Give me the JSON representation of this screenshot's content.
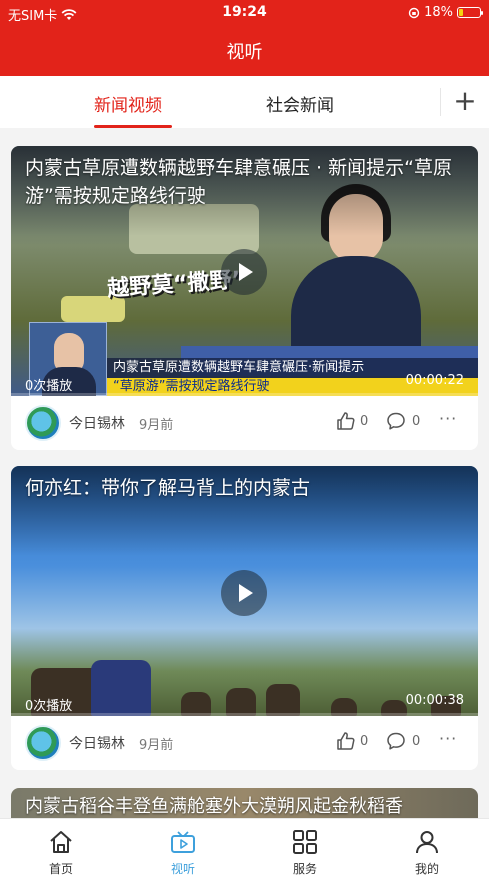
{
  "status_bar": {
    "carrier": "无SIM卡",
    "time": "19:24",
    "battery_percent": "18%",
    "battery_level": 0.18,
    "battery_color": "#f5d40f"
  },
  "header": {
    "title": "视听",
    "accent": "#e2231a"
  },
  "tabs": [
    {
      "label": "新闻视频",
      "active": true
    },
    {
      "label": "社会新闻",
      "active": false
    }
  ],
  "add_tab_icon": "plus-icon",
  "videos": [
    {
      "title": "内蒙古草原遭数辆越野车肆意碾压 · 新闻提示“草原游”需按规定路线行驶",
      "views": "0次播放",
      "duration": "00:00:22",
      "source": "今日锡林",
      "time": "9月前",
      "likes": "0",
      "comments": "0",
      "overlay_sign": "越野莫“撒野”",
      "ticker_line1": "内蒙古草原遭数辆越野车肆意碾压·新闻提示",
      "ticker_line2": "“草原游”需按规定路线行驶"
    },
    {
      "title": "何亦红：带你了解马背上的内蒙古",
      "views": "0次播放",
      "duration": "00:00:38",
      "source": "今日锡林",
      "time": "9月前",
      "likes": "0",
      "comments": "0"
    },
    {
      "title": "内蒙古稻谷丰登鱼满舱塞外大漠朔风起金秋稻香"
    }
  ],
  "bottom_nav": [
    {
      "label": "首页",
      "icon": "home-icon",
      "active": false
    },
    {
      "label": "视听",
      "icon": "tv-icon",
      "active": true
    },
    {
      "label": "服务",
      "icon": "grid-icon",
      "active": false
    },
    {
      "label": "我的",
      "icon": "user-icon",
      "active": false
    }
  ],
  "active_color": "#3ea0dc"
}
